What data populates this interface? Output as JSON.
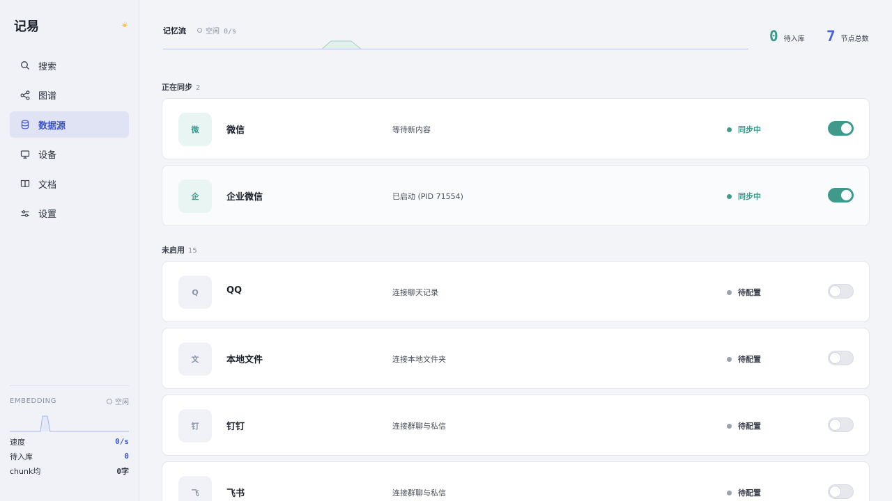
{
  "app": {
    "title": "记易"
  },
  "sidebar": {
    "items": [
      {
        "label": "搜索",
        "icon": "search-icon"
      },
      {
        "label": "图谱",
        "icon": "share-graph-icon"
      },
      {
        "label": "数据源",
        "icon": "database-icon",
        "active": true
      },
      {
        "label": "设备",
        "icon": "monitor-icon"
      },
      {
        "label": "文档",
        "icon": "book-icon"
      },
      {
        "label": "设置",
        "icon": "sliders-icon"
      }
    ],
    "embedding": {
      "title": "EMBEDDING",
      "status": "空闲",
      "rows": [
        {
          "label": "速度",
          "value": "0/s"
        },
        {
          "label": "待入库",
          "value": "0"
        },
        {
          "label": "chunk均",
          "value": "0字"
        }
      ]
    }
  },
  "header": {
    "flow_title": "记忆流",
    "flow_status": "空闲 0/s",
    "pending": {
      "value": "0",
      "label": "待入库"
    },
    "nodes": {
      "value": "7",
      "label": "节点总数"
    }
  },
  "sections": {
    "syncing": {
      "title": "正在同步",
      "count": "2"
    },
    "disabled": {
      "title": "未启用",
      "count": "15"
    }
  },
  "sources": [
    {
      "logo": "微",
      "name": "微信",
      "desc": "等待新内容",
      "status": "同步中",
      "enabled": true
    },
    {
      "logo": "企",
      "name": "企业微信",
      "desc": "已启动 (PID 71554)",
      "status": "同步中",
      "enabled": true
    },
    {
      "logo": "Q",
      "name": "QQ",
      "desc": "连接聊天记录",
      "status": "待配置",
      "enabled": false
    },
    {
      "logo": "文",
      "name": "本地文件",
      "desc": "连接本地文件夹",
      "status": "待配置",
      "enabled": false
    },
    {
      "logo": "钉",
      "name": "钉钉",
      "desc": "连接群聊与私信",
      "status": "待配置",
      "enabled": false
    },
    {
      "logo": "飞",
      "name": "飞书",
      "desc": "连接群聊与私信",
      "status": "待配置",
      "enabled": false
    }
  ],
  "colors": {
    "accent_teal": "#3f9a8c",
    "accent_blue": "#4a66d6",
    "active_nav_bg": "#dfe3f3"
  }
}
